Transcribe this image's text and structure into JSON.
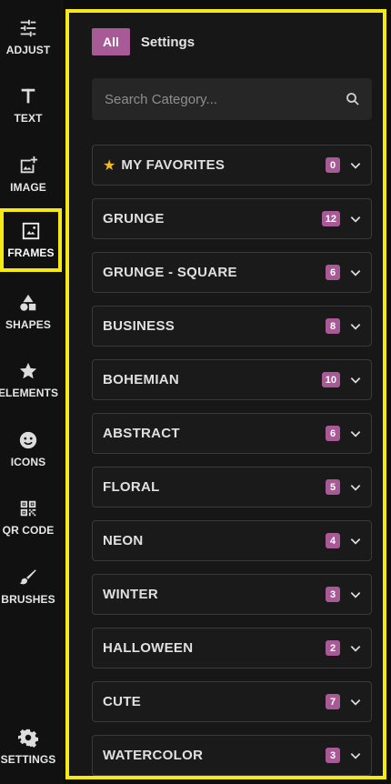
{
  "sidebar": {
    "items": [
      {
        "label": "ADJUST",
        "icon": "sliders-icon"
      },
      {
        "label": "TEXT",
        "icon": "text-icon"
      },
      {
        "label": "IMAGE",
        "icon": "image-add-icon"
      },
      {
        "label": "FRAMES",
        "icon": "frame-icon",
        "active": true
      },
      {
        "label": "SHAPES",
        "icon": "shapes-icon"
      },
      {
        "label": "ELEMENTS",
        "icon": "star-icon"
      },
      {
        "label": "ICONS",
        "icon": "smiley-icon"
      },
      {
        "label": "QR CODE",
        "icon": "qr-code-icon"
      },
      {
        "label": "BRUSHES",
        "icon": "brush-icon"
      }
    ],
    "settings_label": "SETTINGS"
  },
  "panel": {
    "tab_all": "All",
    "tab_settings": "Settings",
    "search_placeholder": "Search Category..."
  },
  "categories": [
    {
      "name": "MY FAVORITES",
      "count": "0",
      "starred": true
    },
    {
      "name": "GRUNGE",
      "count": "12"
    },
    {
      "name": "GRUNGE - SQUARE",
      "count": "6"
    },
    {
      "name": "BUSINESS",
      "count": "8"
    },
    {
      "name": "BOHEMIAN",
      "count": "10"
    },
    {
      "name": "ABSTRACT",
      "count": "6"
    },
    {
      "name": "FLORAL",
      "count": "5"
    },
    {
      "name": "NEON",
      "count": "4"
    },
    {
      "name": "WINTER",
      "count": "3"
    },
    {
      "name": "HALLOWEEN",
      "count": "2"
    },
    {
      "name": "CUTE",
      "count": "7"
    },
    {
      "name": "WATERCOLOR",
      "count": "3"
    }
  ],
  "colors": {
    "accent": "#a85a97",
    "highlight": "#f7ea12",
    "star": "#f2b824"
  }
}
